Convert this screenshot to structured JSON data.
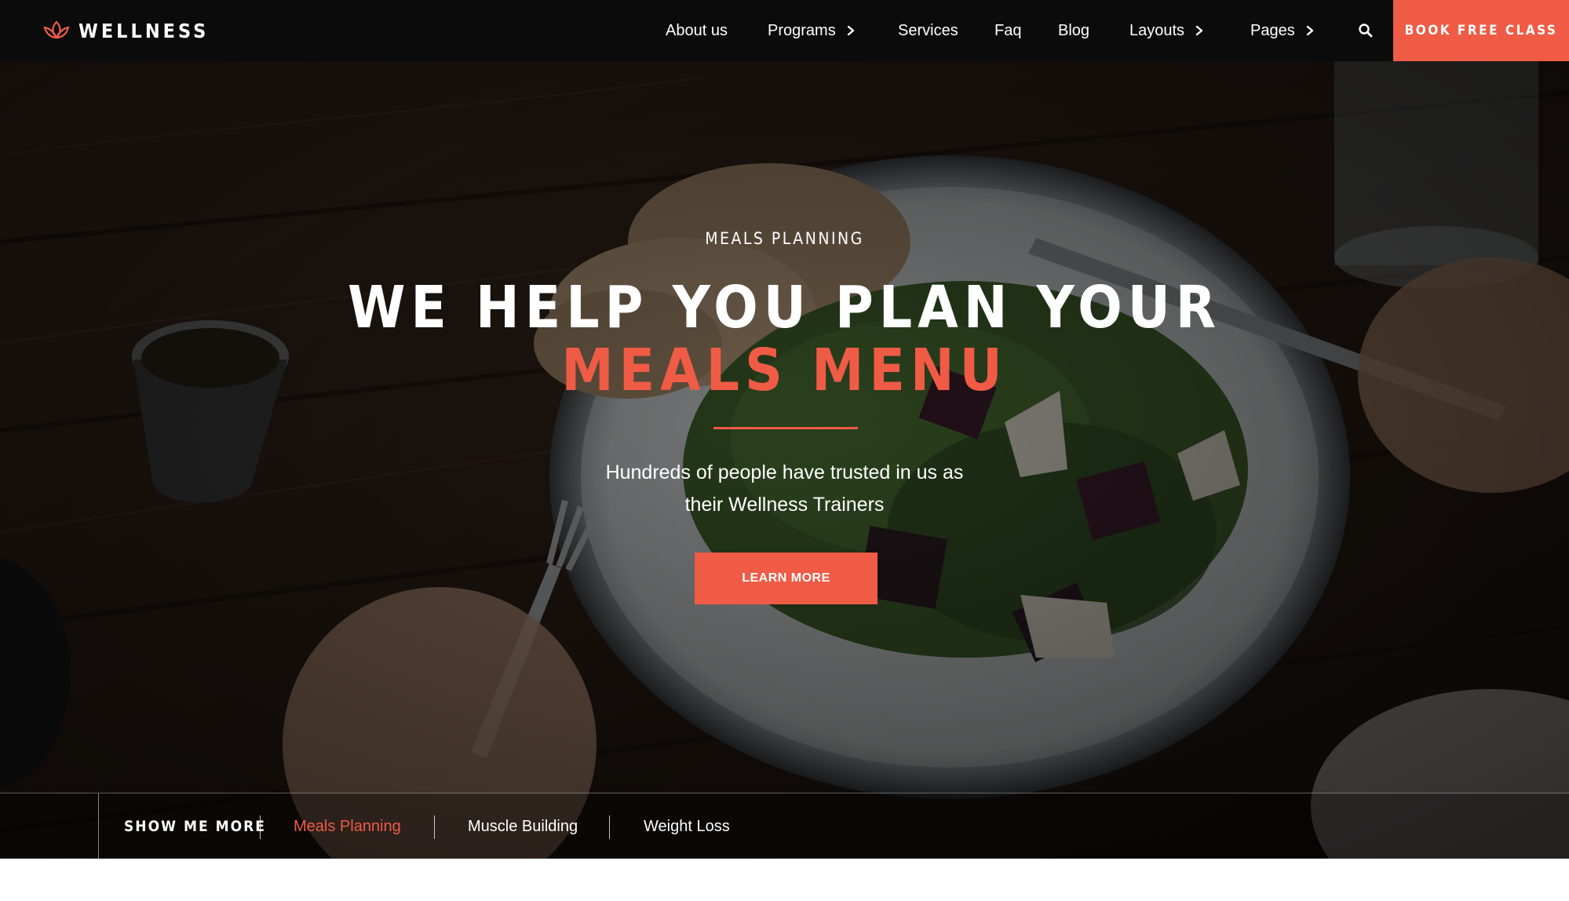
{
  "brand": {
    "name": "WELLNESS",
    "logo_icon": "lotus-icon",
    "accent_color": "#ef5b45"
  },
  "nav": {
    "items": [
      {
        "label": "About us"
      },
      {
        "label": "Programs",
        "has_submenu": true
      },
      {
        "label": "Services"
      },
      {
        "label": "Faq"
      },
      {
        "label": "Blog"
      },
      {
        "label": "Layouts",
        "has_submenu": true
      },
      {
        "label": "Pages",
        "has_submenu": true
      }
    ],
    "search_icon": "search-icon",
    "cta_label": "BOOK FREE CLASS"
  },
  "hero": {
    "eyebrow": "MEALS PLANNING",
    "headline_line1": "WE HELP YOU PLAN YOUR",
    "headline_line2": "MEALS MENU",
    "sub_line1": "Hundreds of people have trusted in us as",
    "sub_line2": "their Wellness Trainers",
    "button_label": "LEARN MORE",
    "background": "photo-salad-plate-on-wooden-table"
  },
  "show_more": {
    "label": "SHOW ME MORE",
    "tabs": [
      {
        "label": "Meals Planning",
        "active": true
      },
      {
        "label": "Muscle Building",
        "active": false
      },
      {
        "label": "Weight Loss",
        "active": false
      }
    ]
  }
}
